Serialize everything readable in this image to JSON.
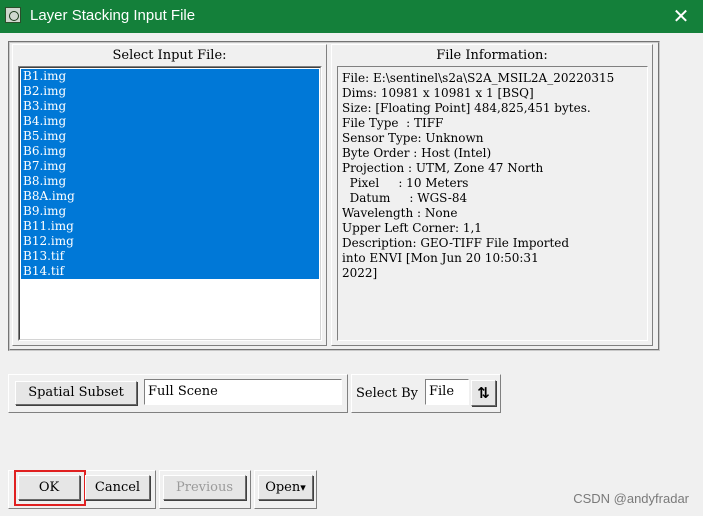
{
  "window": {
    "title": "Layer Stacking Input File",
    "close_glyph": "✕"
  },
  "select_panel": {
    "title": "Select Input File:",
    "files": [
      "B1.img",
      "B2.img",
      "B3.img",
      "B4.img",
      "B5.img",
      "B6.img",
      "B7.img",
      "B8.img",
      "B8A.img",
      "B9.img",
      "B11.img",
      "B12.img",
      "B13.tif",
      "B14.tif"
    ],
    "selected_color": "#0078d7"
  },
  "info_panel": {
    "title": "File Information:",
    "lines": [
      "File: E:\\sentinel\\s2a\\S2A_MSIL2A_20220315",
      "Dims: 10981 x 10981 x 1 [BSQ]",
      "Size: [Floating Point] 484,825,451 bytes.",
      "File Type  : TIFF",
      "Sensor Type: Unknown",
      "Byte Order : Host (Intel)",
      "Projection : UTM, Zone 47 North",
      "  Pixel     : 10 Meters",
      "  Datum     : WGS-84",
      "Wavelength : None",
      "Upper Left Corner: 1,1",
      "Description: GEO-TIFF File Imported",
      "into ENVI [Mon Jun 20 10:50:31",
      "2022]"
    ]
  },
  "subset": {
    "button_label": "Spatial Subset",
    "value": "Full Scene"
  },
  "select_by": {
    "label": "Select By",
    "value": "File",
    "sort_icon": "⇅"
  },
  "buttons": {
    "ok": "OK",
    "cancel": "Cancel",
    "previous": "Previous",
    "open": "Open",
    "open_arrow": "▾"
  },
  "watermark": "CSDN @andyfradar",
  "colors": {
    "titlebar": "#14803a",
    "focus": "#e02020"
  }
}
